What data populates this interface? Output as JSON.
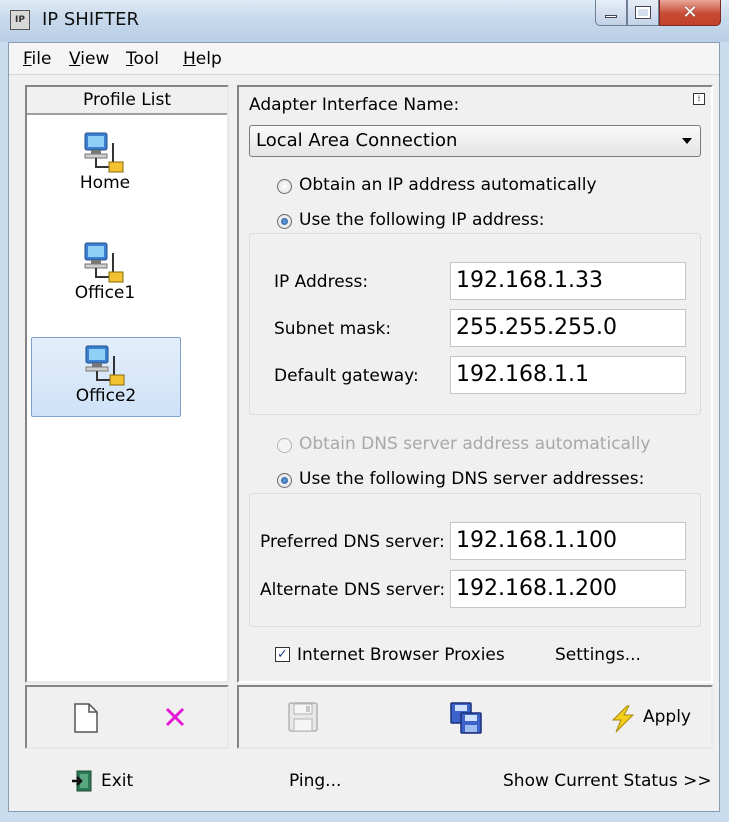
{
  "window": {
    "title": "IP SHIFTER",
    "icon_label": "IP",
    "minimize_icon": "minimize-icon",
    "maximize_icon": "maximize-icon",
    "close_icon": "close-icon"
  },
  "menu": [
    {
      "label": "File",
      "accel": "F",
      "rest": "ile"
    },
    {
      "label": "View",
      "accel": "V",
      "rest": "iew"
    },
    {
      "label": "Tool",
      "accel": "T",
      "rest": "ool"
    },
    {
      "label": "Help",
      "accel": "H",
      "rest": "elp"
    }
  ],
  "profiles": {
    "header": "Profile List",
    "items": [
      {
        "label": "Home",
        "selected": false
      },
      {
        "label": "Office1",
        "selected": false
      },
      {
        "label": "Office2",
        "selected": true
      }
    ]
  },
  "adapter": {
    "label": "Adapter Interface Name:",
    "value": "Local Area Connection"
  },
  "ip": {
    "auto_label": "Obtain an IP address automatically",
    "manual_label": "Use the following IP address:",
    "mode": "manual",
    "address_label": "IP  Address:",
    "address": "192.168.1.33",
    "subnet_label": "Subnet mask:",
    "subnet": "255.255.255.0",
    "gateway_label": "Default gateway:",
    "gateway": "192.168.1.1"
  },
  "dns": {
    "auto_label": "Obtain DNS server address automatically",
    "manual_label": "Use the following DNS server addresses:",
    "mode": "manual",
    "preferred_label": "Preferred DNS server:",
    "preferred": "192.168.1.100",
    "alternate_label": "Alternate DNS server:",
    "alternate": "192.168.1.200"
  },
  "proxies": {
    "label": "Internet Browser Proxies",
    "checked": true,
    "settings_label": "Settings..."
  },
  "toolbar": {
    "new_icon": "new-profile-icon",
    "delete_icon": "delete-profile-icon",
    "save_icon": "save-icon",
    "copy_icon": "copy-icon",
    "apply_label": "Apply",
    "apply_icon": "lightning-icon"
  },
  "footer": {
    "exit_label": "Exit",
    "ping_label": "Ping...",
    "status_label": "Show Current Status >>"
  },
  "colors": {
    "delete_x": "#e21ad6",
    "apply_bolt": "#f2cf1a",
    "selected_profile_bg": "#d6e7fb"
  }
}
